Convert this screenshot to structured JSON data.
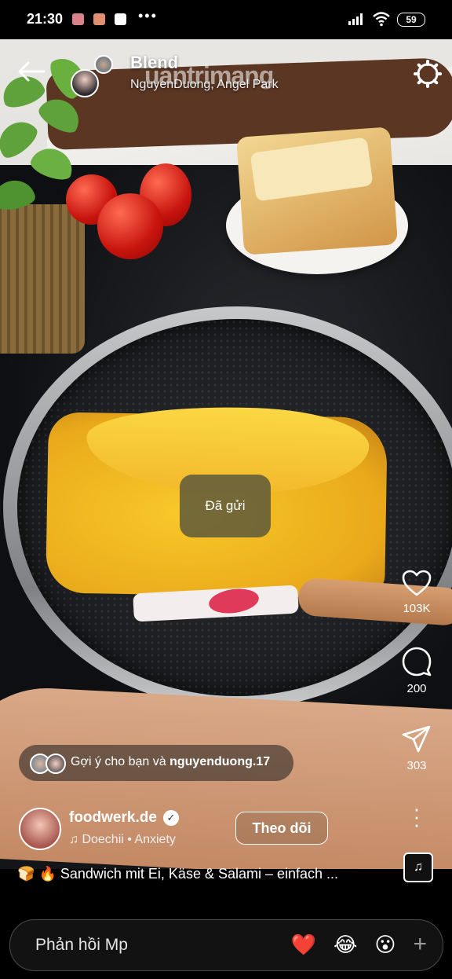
{
  "status_bar": {
    "time": "21:30",
    "battery": "59"
  },
  "header": {
    "title": "Blend",
    "subtitle": "NguyenDuong, Angel Park",
    "watermark": "uantrimang"
  },
  "toast": {
    "text": "Đã gửi"
  },
  "actions": {
    "likes": "103K",
    "comments": "200",
    "shares": "303"
  },
  "suggestion": {
    "prefix": "Gợi ý cho bạn và ",
    "user": "nguyenduong.17"
  },
  "author": {
    "name": "foodwerk.de",
    "music": "Doechii • Anxiety",
    "follow_label": "Theo dõi"
  },
  "caption": {
    "text": "Sandwich mit Ei, Käse & Salami – einfach ..."
  },
  "reply": {
    "placeholder": "Phản hồi Mp",
    "reactions": [
      "❤️",
      "😂",
      "😮"
    ],
    "plus": "+"
  },
  "icons": [
    "back-arrow-icon",
    "settings-icon",
    "heart-icon",
    "comment-icon",
    "share-icon",
    "more-icon",
    "music-note-icon",
    "verified-icon",
    "plus-icon"
  ],
  "colors": {
    "background": "#000000",
    "reply_bar": "#121212",
    "omelette": "#f2b92b"
  }
}
